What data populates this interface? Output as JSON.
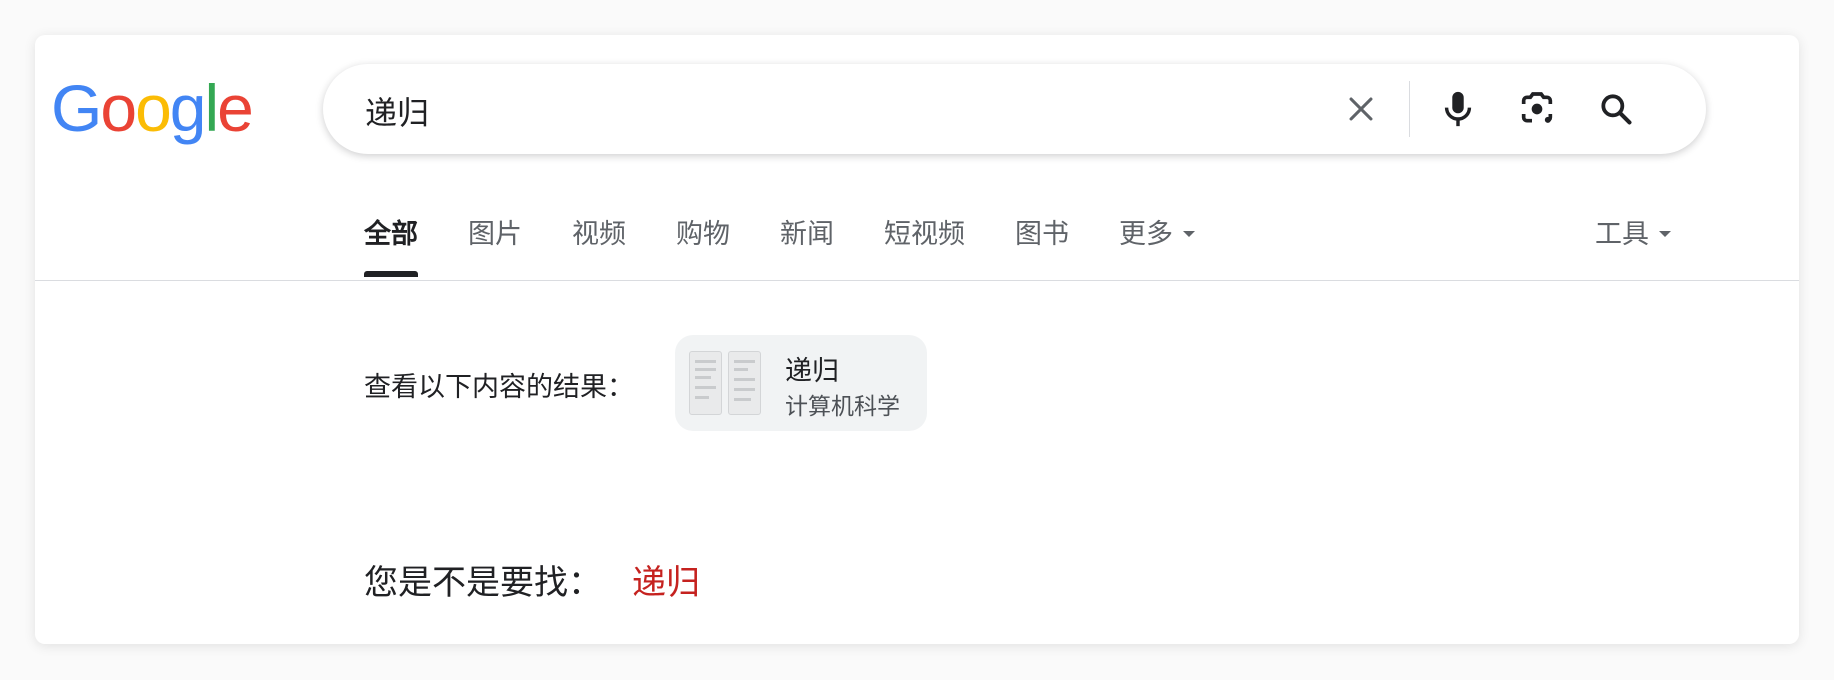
{
  "logo": {
    "letters": [
      "G",
      "o",
      "o",
      "g",
      "l",
      "e"
    ],
    "colors": [
      "#4285F4",
      "#EA4335",
      "#FBBC05",
      "#4285F4",
      "#34A853",
      "#EA4335"
    ]
  },
  "search": {
    "query": "递归",
    "icons": [
      "close-icon",
      "microphone-icon",
      "camera-lens-icon",
      "search-icon"
    ]
  },
  "tabs": [
    {
      "label": "全部",
      "active": true
    },
    {
      "label": "图片"
    },
    {
      "label": "视频"
    },
    {
      "label": "购物"
    },
    {
      "label": "新闻"
    },
    {
      "label": "短视频"
    },
    {
      "label": "图书"
    },
    {
      "label": "更多"
    }
  ],
  "tools_label": "工具",
  "see_results": {
    "label": "查看以下内容的结果：",
    "chip_title": "递归",
    "chip_subtitle": "计算机科学"
  },
  "did_you_mean": {
    "label": "您是不是要找：",
    "suggestion": "递归"
  },
  "colors": {
    "accent_red": "#c5221f",
    "tab_active": "#202124",
    "tab_inactive": "#5f6368"
  }
}
